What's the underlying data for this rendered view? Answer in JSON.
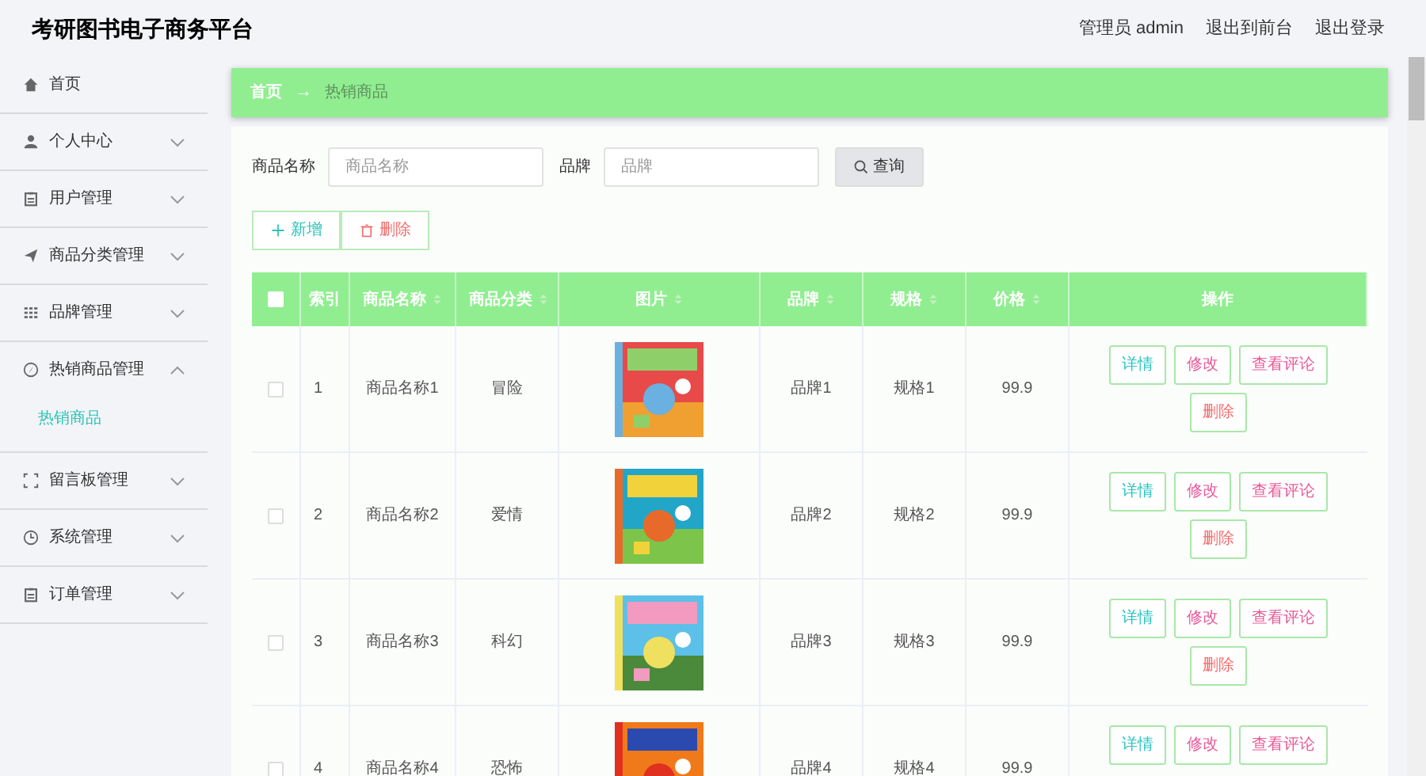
{
  "header": {
    "title": "考研图书电子商务平台",
    "links": [
      "管理员 admin",
      "退出到前台",
      "退出登录"
    ]
  },
  "sidebar": {
    "items": [
      {
        "label": "首页"
      },
      {
        "label": "个人中心",
        "expanded": false
      },
      {
        "label": "用户管理",
        "expanded": false
      },
      {
        "label": "商品分类管理",
        "expanded": false
      },
      {
        "label": "品牌管理",
        "expanded": false
      },
      {
        "label": "热销商品管理",
        "expanded": true,
        "children": [
          {
            "label": "热销商品",
            "selected": true
          }
        ]
      },
      {
        "label": "留言板管理",
        "expanded": false
      },
      {
        "label": "系统管理",
        "expanded": false
      },
      {
        "label": "订单管理",
        "expanded": false
      }
    ]
  },
  "breadcrumb": {
    "items": [
      "首页",
      "热销商品"
    ],
    "separator": "→"
  },
  "search": {
    "fields": [
      {
        "label": "商品名称",
        "placeholder": "商品名称"
      },
      {
        "label": "品牌",
        "placeholder": "品牌"
      }
    ],
    "button": "查询"
  },
  "toolbar": [
    {
      "label": "新增",
      "kind": "add"
    },
    {
      "label": "删除",
      "kind": "delete"
    }
  ],
  "table": {
    "all_checked": false,
    "columns": [
      {
        "label": "索引"
      },
      {
        "label": "商品名称",
        "sortable": true
      },
      {
        "label": "商品分类",
        "sortable": true
      },
      {
        "label": "图片",
        "sortable": true
      },
      {
        "label": "品牌",
        "sortable": true
      },
      {
        "label": "规格",
        "sortable": true
      },
      {
        "label": "价格",
        "sortable": true
      },
      {
        "label": "操作"
      }
    ],
    "rows": [
      {
        "checked": false,
        "index": "1",
        "name": "商品名称1",
        "category": "冒险",
        "image": {
          "kind": "picture"
        },
        "brand": "品牌1",
        "spec": "规格1",
        "price": "99.9",
        "actions": [
          {
            "label": "详情",
            "kind": "detail"
          },
          {
            "label": "修改",
            "kind": "edit"
          },
          {
            "label": "查看评论",
            "kind": "comments"
          },
          {
            "label": "删除",
            "kind": "delete"
          }
        ]
      },
      {
        "checked": false,
        "index": "2",
        "name": "商品名称2",
        "category": "爱情",
        "image": {
          "kind": "picture"
        },
        "brand": "品牌2",
        "spec": "规格2",
        "price": "99.9",
        "actions": [
          {
            "label": "详情",
            "kind": "detail"
          },
          {
            "label": "修改",
            "kind": "edit"
          },
          {
            "label": "查看评论",
            "kind": "comments"
          },
          {
            "label": "删除",
            "kind": "delete"
          }
        ]
      },
      {
        "checked": false,
        "index": "3",
        "name": "商品名称3",
        "category": "科幻",
        "image": {
          "kind": "picture"
        },
        "brand": "品牌3",
        "spec": "规格3",
        "price": "99.9",
        "actions": [
          {
            "label": "详情",
            "kind": "detail"
          },
          {
            "label": "修改",
            "kind": "edit"
          },
          {
            "label": "查看评论",
            "kind": "comments"
          },
          {
            "label": "删除",
            "kind": "delete"
          }
        ]
      },
      {
        "checked": false,
        "index": "4",
        "name": "商品名称4",
        "category": "恐怖",
        "image": {
          "kind": "picture"
        },
        "brand": "品牌4",
        "spec": "规格4",
        "price": "99.9",
        "actions": [
          {
            "label": "详情",
            "kind": "detail"
          },
          {
            "label": "修改",
            "kind": "edit"
          },
          {
            "label": "查看评论",
            "kind": "comments"
          }
        ]
      }
    ]
  }
}
